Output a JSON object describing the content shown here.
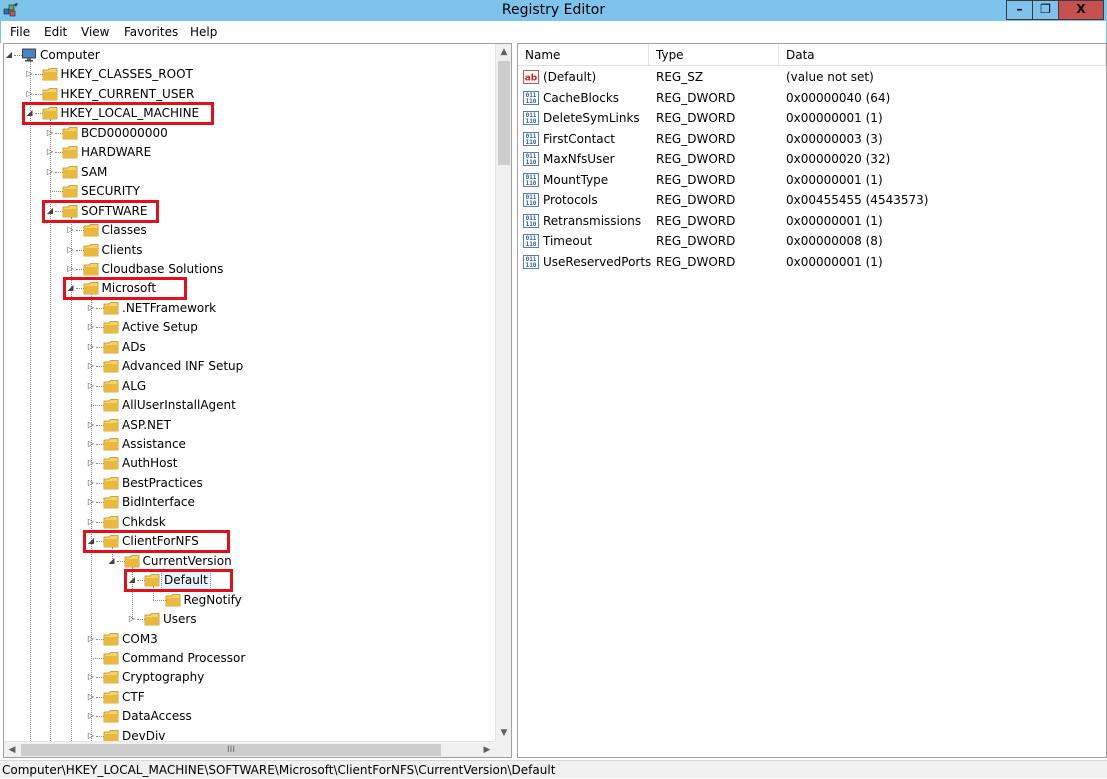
{
  "window": {
    "title": "Registry Editor",
    "app_icon": "regedit-icon",
    "minimize_label": "–",
    "restore_label": "❐",
    "close_label": "X"
  },
  "menu": [
    {
      "label": "File"
    },
    {
      "label": "Edit"
    },
    {
      "label": "View"
    },
    {
      "label": "Favorites"
    },
    {
      "label": "Help"
    }
  ],
  "tree": {
    "items": [
      {
        "label": "Computer",
        "depth": 0,
        "expander": "expanded",
        "icon": "computer-icon",
        "highlighted": false
      },
      {
        "label": "HKEY_CLASSES_ROOT",
        "depth": 1,
        "expander": "collapsed",
        "icon": "folder-icon",
        "highlighted": false
      },
      {
        "label": "HKEY_CURRENT_USER",
        "depth": 1,
        "expander": "collapsed",
        "icon": "folder-icon",
        "highlighted": false
      },
      {
        "label": "HKEY_LOCAL_MACHINE",
        "depth": 1,
        "expander": "expanded",
        "icon": "folder-icon",
        "highlighted": true
      },
      {
        "label": "BCD00000000",
        "depth": 2,
        "expander": "collapsed",
        "icon": "folder-icon",
        "highlighted": false
      },
      {
        "label": "HARDWARE",
        "depth": 2,
        "expander": "collapsed",
        "icon": "folder-icon",
        "highlighted": false
      },
      {
        "label": "SAM",
        "depth": 2,
        "expander": "collapsed",
        "icon": "folder-icon",
        "highlighted": false
      },
      {
        "label": "SECURITY",
        "depth": 2,
        "expander": "none",
        "icon": "folder-icon",
        "highlighted": false
      },
      {
        "label": "SOFTWARE",
        "depth": 2,
        "expander": "expanded",
        "icon": "folder-icon",
        "highlighted": true
      },
      {
        "label": "Classes",
        "depth": 3,
        "expander": "collapsed",
        "icon": "folder-icon",
        "highlighted": false
      },
      {
        "label": "Clients",
        "depth": 3,
        "expander": "collapsed",
        "icon": "folder-icon",
        "highlighted": false
      },
      {
        "label": "Cloudbase Solutions",
        "depth": 3,
        "expander": "collapsed",
        "icon": "folder-icon",
        "highlighted": false
      },
      {
        "label": "Microsoft",
        "depth": 3,
        "expander": "expanded",
        "icon": "folder-icon",
        "highlighted": true
      },
      {
        "label": ".NETFramework",
        "depth": 4,
        "expander": "collapsed",
        "icon": "folder-icon",
        "highlighted": false
      },
      {
        "label": "Active Setup",
        "depth": 4,
        "expander": "collapsed",
        "icon": "folder-icon",
        "highlighted": false
      },
      {
        "label": "ADs",
        "depth": 4,
        "expander": "collapsed",
        "icon": "folder-icon",
        "highlighted": false
      },
      {
        "label": "Advanced INF Setup",
        "depth": 4,
        "expander": "collapsed",
        "icon": "folder-icon",
        "highlighted": false
      },
      {
        "label": "ALG",
        "depth": 4,
        "expander": "collapsed",
        "icon": "folder-icon",
        "highlighted": false
      },
      {
        "label": "AllUserInstallAgent",
        "depth": 4,
        "expander": "none",
        "icon": "folder-icon",
        "highlighted": false
      },
      {
        "label": "ASP.NET",
        "depth": 4,
        "expander": "collapsed",
        "icon": "folder-icon",
        "highlighted": false
      },
      {
        "label": "Assistance",
        "depth": 4,
        "expander": "collapsed",
        "icon": "folder-icon",
        "highlighted": false
      },
      {
        "label": "AuthHost",
        "depth": 4,
        "expander": "collapsed",
        "icon": "folder-icon",
        "highlighted": false
      },
      {
        "label": "BestPractices",
        "depth": 4,
        "expander": "collapsed",
        "icon": "folder-icon",
        "highlighted": false
      },
      {
        "label": "BidInterface",
        "depth": 4,
        "expander": "collapsed",
        "icon": "folder-icon",
        "highlighted": false
      },
      {
        "label": "Chkdsk",
        "depth": 4,
        "expander": "collapsed",
        "icon": "folder-icon",
        "highlighted": false
      },
      {
        "label": "ClientForNFS",
        "depth": 4,
        "expander": "expanded",
        "icon": "folder-icon",
        "highlighted": true
      },
      {
        "label": "CurrentVersion",
        "depth": 5,
        "expander": "expanded",
        "icon": "folder-icon",
        "highlighted": false
      },
      {
        "label": "Default",
        "depth": 6,
        "expander": "expanded",
        "icon": "folder-icon",
        "highlighted": true,
        "selected": true
      },
      {
        "label": "RegNotify",
        "depth": 7,
        "expander": "none",
        "icon": "folder-icon",
        "highlighted": false
      },
      {
        "label": "Users",
        "depth": 6,
        "expander": "collapsed",
        "icon": "folder-icon",
        "highlighted": false
      },
      {
        "label": "COM3",
        "depth": 4,
        "expander": "collapsed",
        "icon": "folder-icon",
        "highlighted": false
      },
      {
        "label": "Command Processor",
        "depth": 4,
        "expander": "none",
        "icon": "folder-icon",
        "highlighted": false
      },
      {
        "label": "Cryptography",
        "depth": 4,
        "expander": "collapsed",
        "icon": "folder-icon",
        "highlighted": false
      },
      {
        "label": "CTF",
        "depth": 4,
        "expander": "collapsed",
        "icon": "folder-icon",
        "highlighted": false
      },
      {
        "label": "DataAccess",
        "depth": 4,
        "expander": "collapsed",
        "icon": "folder-icon",
        "highlighted": false
      },
      {
        "label": "DevDiv",
        "depth": 4,
        "expander": "collapsed",
        "icon": "folder-icon",
        "highlighted": false
      }
    ],
    "hscroll_thumb_label": "III"
  },
  "values": {
    "columns": {
      "name": "Name",
      "type": "Type",
      "data": "Data"
    },
    "rows": [
      {
        "icon": "string-value-icon",
        "name": "(Default)",
        "type": "REG_SZ",
        "data": "(value not set)"
      },
      {
        "icon": "binary-value-icon",
        "name": "CacheBlocks",
        "type": "REG_DWORD",
        "data": "0x00000040 (64)"
      },
      {
        "icon": "binary-value-icon",
        "name": "DeleteSymLinks",
        "type": "REG_DWORD",
        "data": "0x00000001 (1)"
      },
      {
        "icon": "binary-value-icon",
        "name": "FirstContact",
        "type": "REG_DWORD",
        "data": "0x00000003 (3)"
      },
      {
        "icon": "binary-value-icon",
        "name": "MaxNfsUser",
        "type": "REG_DWORD",
        "data": "0x00000020 (32)"
      },
      {
        "icon": "binary-value-icon",
        "name": "MountType",
        "type": "REG_DWORD",
        "data": "0x00000001 (1)"
      },
      {
        "icon": "binary-value-icon",
        "name": "Protocols",
        "type": "REG_DWORD",
        "data": "0x00455455 (4543573)"
      },
      {
        "icon": "binary-value-icon",
        "name": "Retransmissions",
        "type": "REG_DWORD",
        "data": "0x00000001 (1)"
      },
      {
        "icon": "binary-value-icon",
        "name": "Timeout",
        "type": "REG_DWORD",
        "data": "0x00000008 (8)"
      },
      {
        "icon": "binary-value-icon",
        "name": "UseReservedPorts",
        "type": "REG_DWORD",
        "data": "0x00000001 (1)"
      }
    ]
  },
  "status": {
    "path": "Computer\\HKEY_LOCAL_MACHINE\\SOFTWARE\\Microsoft\\ClientForNFS\\CurrentVersion\\Default"
  },
  "colors": {
    "titlebar": "#7ec3ec",
    "highlight_box": "#e3101c",
    "folder": "#e8c24a",
    "selection": "#e5f3fb"
  }
}
